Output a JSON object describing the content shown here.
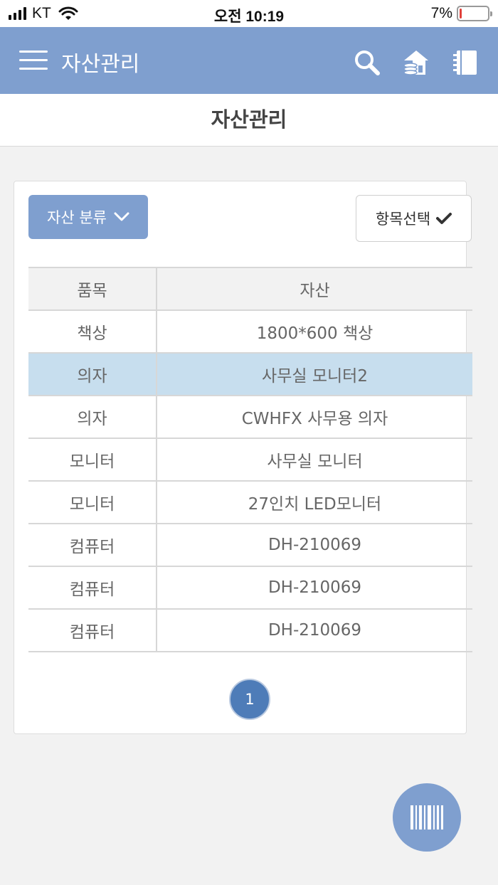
{
  "status_bar": {
    "carrier": "KT",
    "time": "오전 10:19",
    "battery_percent": "7%",
    "battery_level": 0.07
  },
  "header": {
    "title": "자산관리",
    "icons": [
      "menu-icon",
      "search-icon",
      "home-asset-icon",
      "notebook-icon"
    ]
  },
  "sub_header": {
    "title": "자산관리"
  },
  "filters": {
    "category_label": "자산 분류",
    "select_label": "항목선택"
  },
  "table": {
    "columns": [
      "품목",
      "자산"
    ],
    "rows": [
      [
        "책상",
        "1800*600 책상"
      ],
      [
        "의자",
        "사무실 모니터2"
      ],
      [
        "의자",
        "CWHFX 사무용 의자"
      ],
      [
        "모니터",
        "사무실 모니터"
      ],
      [
        "모니터",
        "27인치 LED모니터"
      ],
      [
        "컴퓨터",
        "DH-210069"
      ],
      [
        "컴퓨터",
        "DH-210069"
      ],
      [
        "컴퓨터",
        "DH-210069"
      ]
    ],
    "selected_row": 1
  },
  "pagination": {
    "current": "1"
  },
  "fab": {
    "icon": "barcode-icon"
  },
  "colors": {
    "primary": "#7f9fcf",
    "page_active": "#4e7cb8",
    "row_selected": "#c7deee"
  }
}
